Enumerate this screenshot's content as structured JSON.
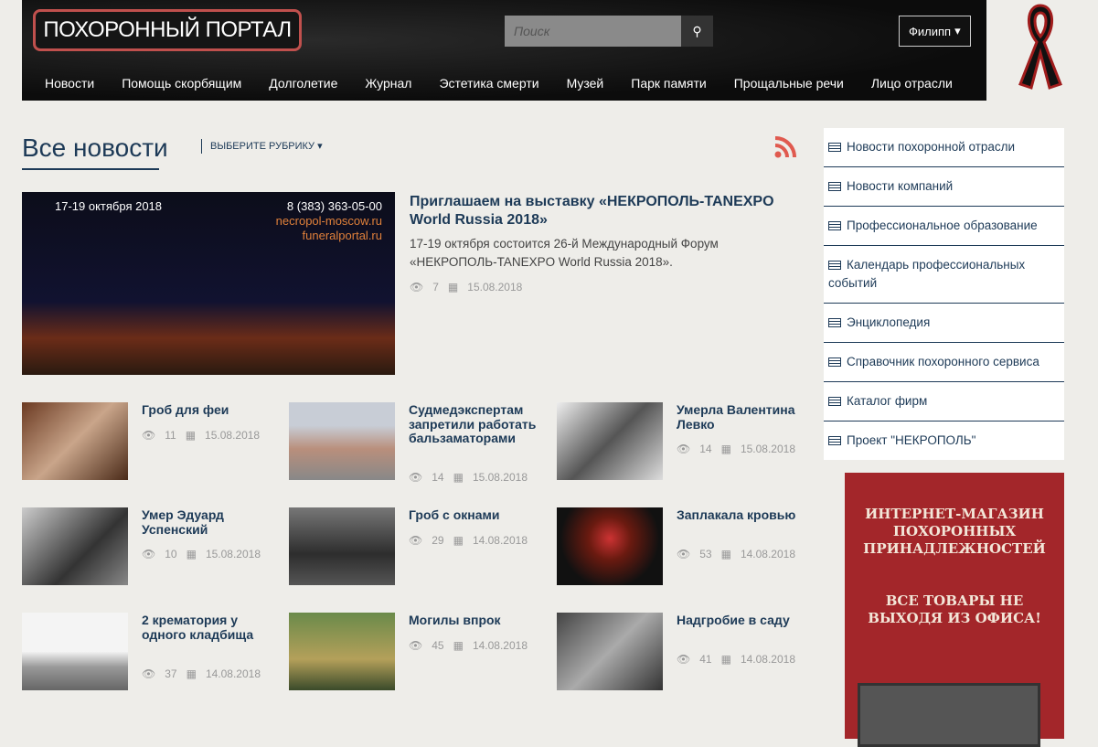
{
  "header": {
    "logo": "ПОХОРОННЫЙ ПОРТАЛ",
    "search_placeholder": "Поиск",
    "user": "Филипп",
    "nav": [
      "Новости",
      "Помощь скорбящим",
      "Долголетие",
      "Журнал",
      "Эстетика смерти",
      "Музей",
      "Парк памяти",
      "Прощальные речи",
      "Лицо отрасли"
    ]
  },
  "main": {
    "title": "Все новости",
    "rubric": "ВЫБЕРИТЕ РУБРИКУ",
    "featured": {
      "title": "Приглашаем на выставку «НЕКРОПОЛЬ-TANEXPO World Russia 2018»",
      "desc": "17-19 октября состоится 26-й Международный Форум «НЕКРОПОЛЬ-TANEXPO World Russia 2018».",
      "views": "7",
      "date": "15.08.2018",
      "img_text": {
        "dates": "17-19 октября 2018",
        "phone": "8 (383) 363-05-00",
        "site1": "necropol-moscow.ru",
        "site2": "funeralportal.ru"
      }
    },
    "cards": [
      {
        "title": "Гроб для феи",
        "views": "11",
        "date": "15.08.2018"
      },
      {
        "title": "Судмедэкспертам запретили работать бальзаматорами",
        "views": "14",
        "date": "15.08.2018"
      },
      {
        "title": "Умерла Валентина Левко",
        "views": "14",
        "date": "15.08.2018"
      },
      {
        "title": "Умер Эдуард Успенский",
        "views": "10",
        "date": "15.08.2018"
      },
      {
        "title": "Гроб с окнами",
        "views": "29",
        "date": "14.08.2018"
      },
      {
        "title": "Заплакала кровью",
        "views": "53",
        "date": "14.08.2018"
      },
      {
        "title": "2 крематория у одного кладбища",
        "views": "37",
        "date": "14.08.2018"
      },
      {
        "title": "Могилы впрок",
        "views": "45",
        "date": "14.08.2018"
      },
      {
        "title": "Надгробие в саду",
        "views": "41",
        "date": "14.08.2018"
      }
    ]
  },
  "sidebar": [
    "Новости похоронной отрасли",
    "Новости компаний",
    "Профессиональное образование",
    "Календарь профессиональных событий",
    "Энциклопедия",
    "Справочник похоронного сервиса",
    "Каталог фирм",
    "Проект \"НЕКРОПОЛЬ\""
  ],
  "banner": {
    "line1": "ИНТЕРНЕТ-МАГАЗИН ПОХОРОННЫХ ПРИНАДЛЕЖНОСТЕЙ",
    "line2": "ВСЕ ТОВАРЫ НЕ ВЫХОДЯ ИЗ ОФИСА!"
  }
}
